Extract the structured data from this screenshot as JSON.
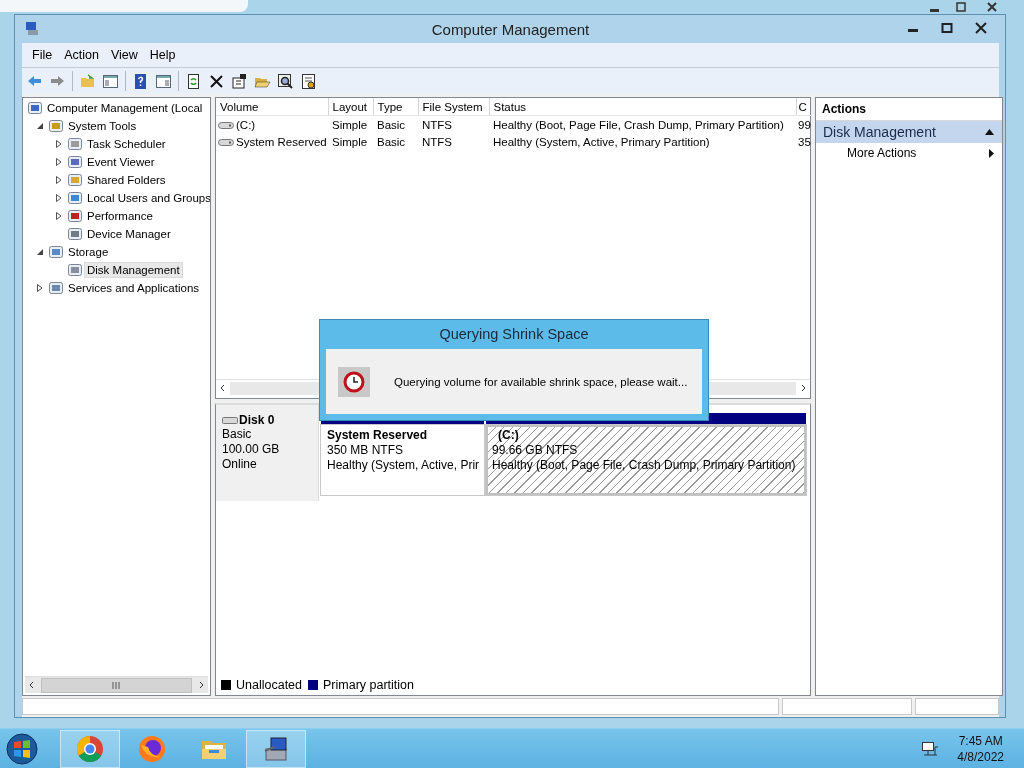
{
  "window": {
    "title": "Computer Management"
  },
  "menu": [
    "File",
    "Action",
    "View",
    "Help"
  ],
  "tree": [
    {
      "label": "Computer Management (Local",
      "expandable": false,
      "selected": false,
      "children": [
        {
          "label": "System Tools",
          "expandable": true,
          "expanded": true,
          "selected": false,
          "children": [
            {
              "label": "Task Scheduler",
              "expandable": true,
              "expanded": false,
              "selected": false
            },
            {
              "label": "Event Viewer",
              "expandable": true,
              "expanded": false,
              "selected": false
            },
            {
              "label": "Shared Folders",
              "expandable": true,
              "expanded": false,
              "selected": false
            },
            {
              "label": "Local Users and Groups",
              "expandable": true,
              "expanded": false,
              "selected": false
            },
            {
              "label": "Performance",
              "expandable": true,
              "expanded": false,
              "selected": false
            },
            {
              "label": "Device Manager",
              "expandable": false,
              "selected": false
            }
          ]
        },
        {
          "label": "Storage",
          "expandable": true,
          "expanded": true,
          "selected": false,
          "children": [
            {
              "label": "Disk Management",
              "expandable": false,
              "selected": true
            }
          ]
        },
        {
          "label": "Services and Applications",
          "expandable": true,
          "expanded": false,
          "selected": false
        }
      ]
    }
  ],
  "table": {
    "columns": [
      "Volume",
      "Layout",
      "Type",
      "File System",
      "Status",
      "C"
    ],
    "rows": [
      {
        "cells": [
          "(C:)",
          "Simple",
          "Basic",
          "NTFS",
          "Healthy (Boot, Page File, Crash Dump, Primary Partition)",
          "99"
        ]
      },
      {
        "cells": [
          "System Reserved",
          "Simple",
          "Basic",
          "NTFS",
          "Healthy (System, Active, Primary Partition)",
          "35"
        ]
      }
    ]
  },
  "disk": {
    "name": "Disk 0",
    "type": "Basic",
    "size": "100.00 GB",
    "status": "Online",
    "partitions": [
      {
        "name": "System Reserved",
        "size": "350 MB NTFS",
        "status": "Healthy (System, Active, Prir",
        "selected": false
      },
      {
        "name": "(C:)",
        "size": "99.66 GB NTFS",
        "status": "Healthy (Boot, Page File, Crash Dump, Primary Partition)",
        "selected": true
      }
    ]
  },
  "legend": [
    {
      "label": "Unallocated",
      "color": "#000000"
    },
    {
      "label": "Primary partition",
      "color": "#000080"
    }
  ],
  "actions": {
    "title": "Actions",
    "sections": [
      {
        "title": "Disk Management",
        "expanded": true,
        "items": [
          {
            "label": "More Actions",
            "submenu": true
          }
        ]
      }
    ]
  },
  "dialog": {
    "title": "Querying Shrink Space",
    "message": "Querying volume for available shrink space, please wait..."
  },
  "taskbar": {
    "apps": [
      {
        "kind": "chrome",
        "running": true
      },
      {
        "kind": "firefox",
        "running": false
      },
      {
        "kind": "explorer",
        "running": false
      },
      {
        "kind": "compmgmt",
        "running": true
      }
    ],
    "time": "7:45 AM",
    "date": "4/8/2022"
  }
}
